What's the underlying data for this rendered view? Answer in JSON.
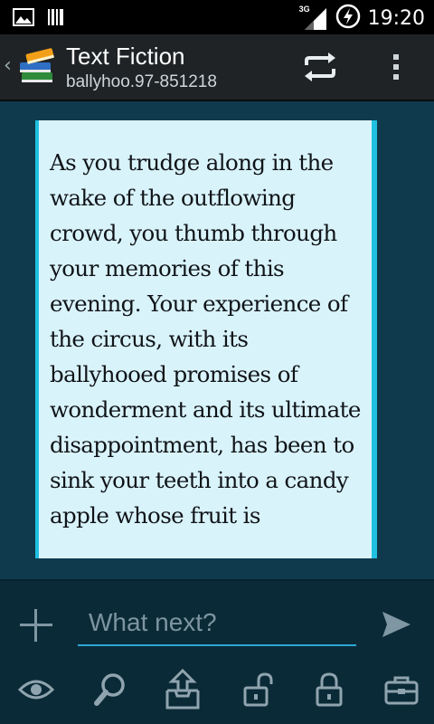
{
  "status_bar": {
    "network_label": "3G",
    "time": "19:20"
  },
  "action_bar": {
    "title": "Text Fiction",
    "subtitle": "ballyhoo.97-851218"
  },
  "story": {
    "text": "As you trudge along in the wake of the outflowing crowd, you thumb through your memories of this evening. Your experience of the circus, with its ballyhooed promises of wonderment and its ultimate disappointment, has been to sink your teeth into a candy apple whose fruit is"
  },
  "input": {
    "placeholder": "What next?"
  },
  "colors": {
    "accent": "#1fc0e0",
    "background": "#0f3a4d",
    "panel": "#d9f3fb"
  }
}
